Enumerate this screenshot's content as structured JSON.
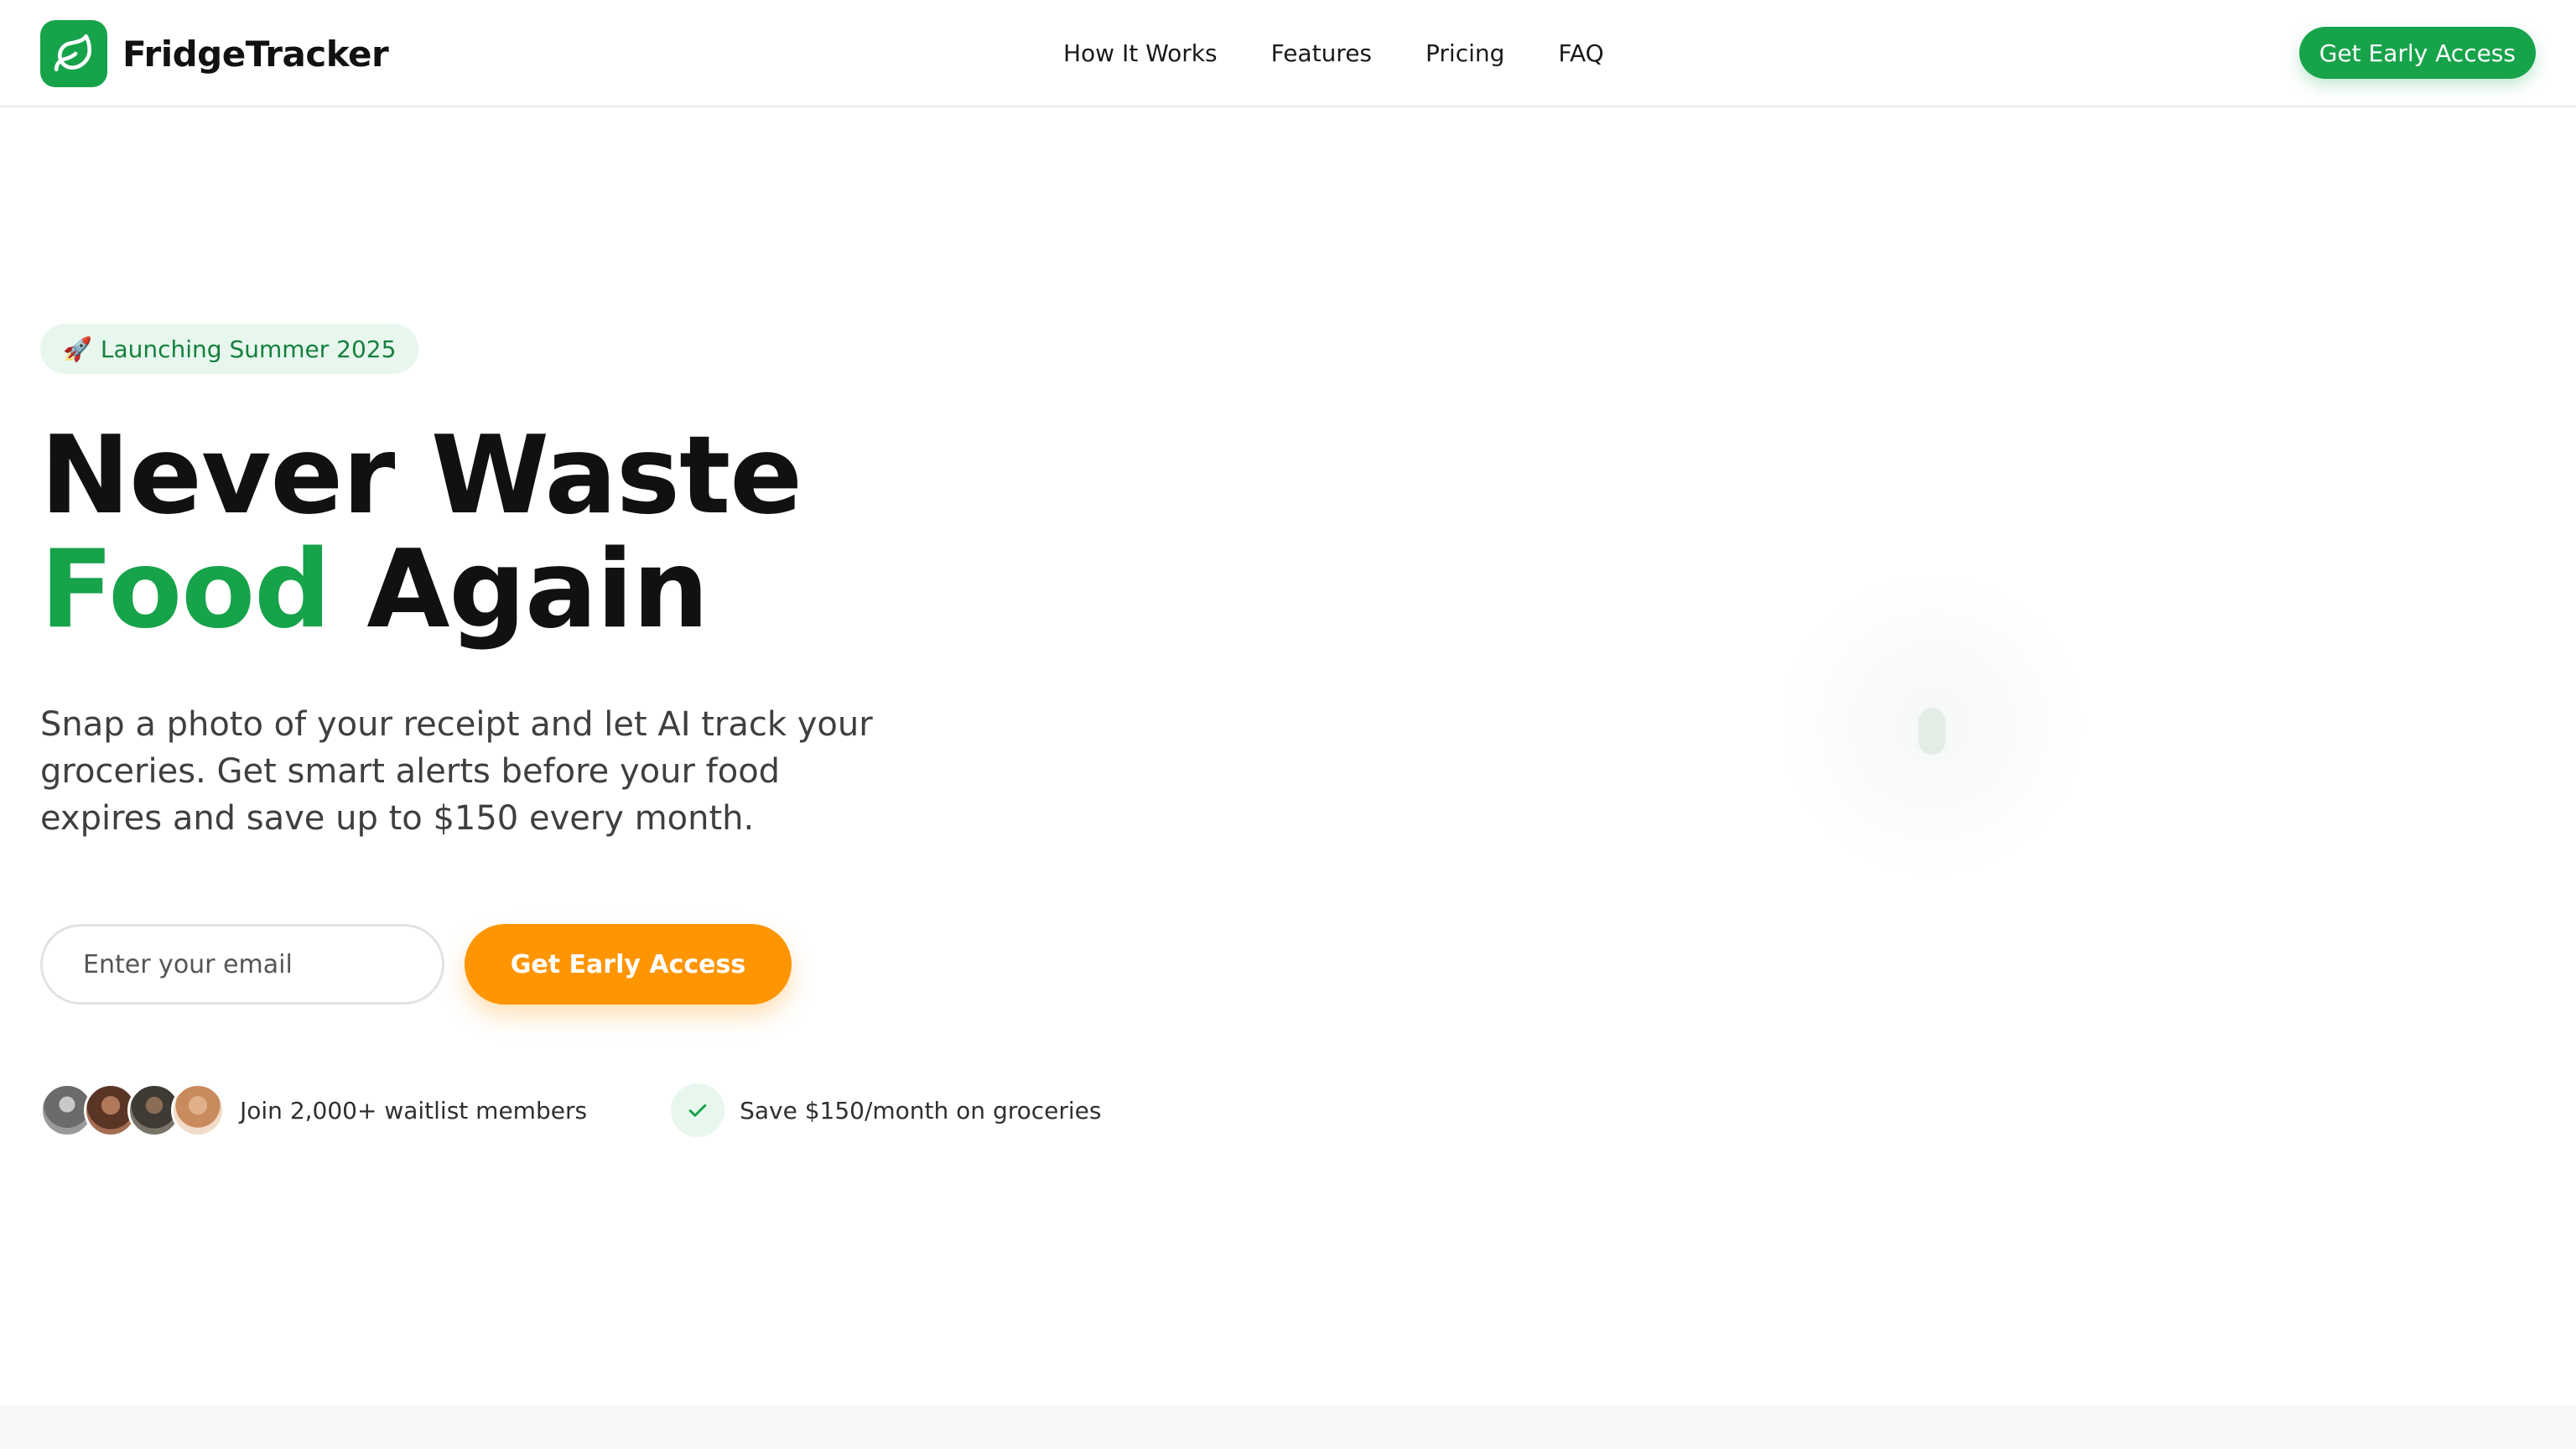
{
  "nav": {
    "brand_name": "FridgeTracker",
    "links": [
      "How It Works",
      "Features",
      "Pricing",
      "FAQ"
    ],
    "cta_label": "Get Early Access"
  },
  "hero": {
    "badge_emoji": "🚀",
    "badge_text": "Launching Summer 2025",
    "headline_line1": "Never Waste",
    "headline_accent": "Food",
    "headline_rest": "Again",
    "subtext": "Snap a photo of your receipt and let AI track your groceries. Get smart alerts before your food expires and save up to $150 every month.",
    "email_placeholder": "Enter your email",
    "cta_label": "Get Early Access"
  },
  "proof": {
    "waitlist_text": "Join 2,000+ waitlist members",
    "savings_text": "Save $150/month on groceries"
  },
  "colors": {
    "brand_green": "#16a34a",
    "cta_orange": "#ff9500",
    "badge_bg": "#e8f7ee"
  }
}
